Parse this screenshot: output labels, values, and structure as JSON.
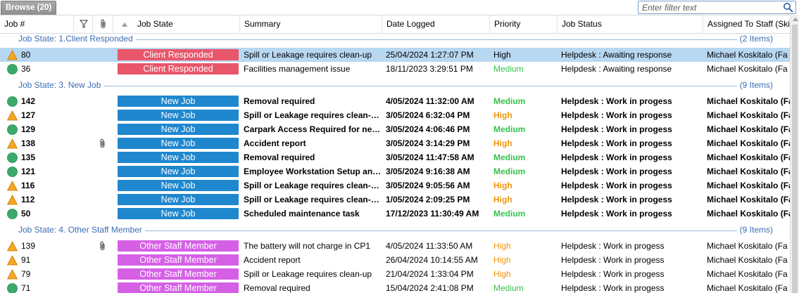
{
  "tab": {
    "label": "Browse (20)"
  },
  "filter": {
    "placeholder": "Enter filter text"
  },
  "columns": {
    "job_no": "Job #",
    "job_state": "Job State",
    "summary": "Summary",
    "date_logged": "Date Logged",
    "priority": "Priority",
    "job_status": "Job Status",
    "assigned": "Assigned To Staff (Ski"
  },
  "groups": [
    {
      "label": "Job State: 1.Client Responded",
      "count": "(2 Items)",
      "rows": [
        {
          "icon": "warning",
          "job": "80",
          "state": "Client Responded",
          "state_kind": "client",
          "summary": "Spill or Leakage requires clean-up",
          "date": "25/04/2024 1:27:07 PM",
          "priority": "High",
          "status": "Helpdesk : Awaiting response",
          "assigned": "Michael Koskitalo (Fa",
          "bold": false,
          "selected": true,
          "attach": false
        },
        {
          "icon": "circle",
          "job": "36",
          "state": "Client Responded",
          "state_kind": "client",
          "summary": "Facilities management issue",
          "date": "18/11/2023 3:29:51 PM",
          "priority": "Medium",
          "status": "Helpdesk : Awaiting response",
          "assigned": "Michael Koskitalo (Fa",
          "bold": false,
          "selected": false,
          "attach": false
        }
      ]
    },
    {
      "label": "Job State: 3. New Job",
      "count": "(9 Items)",
      "rows": [
        {
          "icon": "circle",
          "job": "142",
          "state": "New Job",
          "state_kind": "new",
          "summary": "Removal required",
          "date": "4/05/2024 11:32:00 AM",
          "priority": "Medium",
          "status": "Helpdesk : Work in progess",
          "assigned": "Michael Koskitalo (Fa",
          "bold": true,
          "selected": false,
          "attach": false
        },
        {
          "icon": "warning",
          "job": "127",
          "state": "New Job",
          "state_kind": "new",
          "summary": "Spill or Leakage requires clean-…",
          "date": "3/05/2024 6:32:04 PM",
          "priority": "High",
          "status": "Helpdesk : Work in progess",
          "assigned": "Michael Koskitalo (Fa",
          "bold": true,
          "selected": false,
          "attach": false
        },
        {
          "icon": "circle",
          "job": "129",
          "state": "New Job",
          "state_kind": "new",
          "summary": "Carpark Access Required for ne…",
          "date": "3/05/2024 4:06:46 PM",
          "priority": "Medium",
          "status": "Helpdesk : Work in progess",
          "assigned": "Michael Koskitalo (Fa",
          "bold": true,
          "selected": false,
          "attach": false
        },
        {
          "icon": "warning",
          "job": "138",
          "state": "New Job",
          "state_kind": "new",
          "summary": "Accident report",
          "date": "3/05/2024 3:14:29 PM",
          "priority": "High",
          "status": "Helpdesk : Work in progess",
          "assigned": "Michael Koskitalo (Fa",
          "bold": true,
          "selected": false,
          "attach": true
        },
        {
          "icon": "circle",
          "job": "135",
          "state": "New Job",
          "state_kind": "new",
          "summary": "Removal required",
          "date": "3/05/2024 11:47:58 AM",
          "priority": "Medium",
          "status": "Helpdesk : Work in progess",
          "assigned": "Michael Koskitalo (Fa",
          "bold": true,
          "selected": false,
          "attach": false
        },
        {
          "icon": "circle",
          "job": "121",
          "state": "New Job",
          "state_kind": "new",
          "summary": "Employee Workstation Setup an…",
          "date": "3/05/2024 9:16:38 AM",
          "priority": "Medium",
          "status": "Helpdesk : Work in progess",
          "assigned": "Michael Koskitalo (Fa",
          "bold": true,
          "selected": false,
          "attach": false
        },
        {
          "icon": "warning",
          "job": "116",
          "state": "New Job",
          "state_kind": "new",
          "summary": "Spill or Leakage requires clean-…",
          "date": "3/05/2024 9:05:56 AM",
          "priority": "High",
          "status": "Helpdesk : Work in progess",
          "assigned": "Michael Koskitalo (Fa",
          "bold": true,
          "selected": false,
          "attach": false
        },
        {
          "icon": "warning",
          "job": "112",
          "state": "New Job",
          "state_kind": "new",
          "summary": "Spill or Leakage requires clean-…",
          "date": "1/05/2024 2:09:25 PM",
          "priority": "High",
          "status": "Helpdesk : Work in progess",
          "assigned": "Michael Koskitalo (Fa",
          "bold": true,
          "selected": false,
          "attach": false
        },
        {
          "icon": "circle",
          "job": "50",
          "state": "New Job",
          "state_kind": "new",
          "summary": "Scheduled maintenance task",
          "date": "17/12/2023 11:30:49 AM",
          "priority": "Medium",
          "status": "Helpdesk : Work in progess",
          "assigned": "Michael Koskitalo (Fa",
          "bold": true,
          "selected": false,
          "attach": false
        }
      ]
    },
    {
      "label": "Job State: 4. Other Staff Member",
      "count": "(9 Items)",
      "rows": [
        {
          "icon": "warning",
          "job": "139",
          "state": "Other Staff Member",
          "state_kind": "other",
          "summary": "The battery will not charge in CP1",
          "date": "4/05/2024 11:33:50 AM",
          "priority": "High",
          "status": "Helpdesk : Work in progess",
          "assigned": "Michael Koskitalo (Fa",
          "bold": false,
          "selected": false,
          "attach": true
        },
        {
          "icon": "warning",
          "job": "91",
          "state": "Other Staff Member",
          "state_kind": "other",
          "summary": "Accident report",
          "date": "26/04/2024 10:14:55 AM",
          "priority": "High",
          "status": "Helpdesk : Work in progess",
          "assigned": "Michael Koskitalo (Fa",
          "bold": false,
          "selected": false,
          "attach": false
        },
        {
          "icon": "warning",
          "job": "79",
          "state": "Other Staff Member",
          "state_kind": "other",
          "summary": "Spill or Leakage requires clean-up",
          "date": "21/04/2024 1:33:04 PM",
          "priority": "High",
          "status": "Helpdesk : Work in progess",
          "assigned": "Michael Koskitalo (Fa",
          "bold": false,
          "selected": false,
          "attach": false
        },
        {
          "icon": "circle",
          "job": "71",
          "state": "Other Staff Member",
          "state_kind": "other",
          "summary": "Removal required",
          "date": "15/04/2024 2:41:08 PM",
          "priority": "Medium",
          "status": "Helpdesk : Work in progess",
          "assigned": "Michael Koskitalo (Fa",
          "bold": false,
          "selected": false,
          "attach": false
        }
      ]
    }
  ],
  "colors": {
    "client": "#e8566a",
    "new": "#1f87ce",
    "other": "#d560e6",
    "high": "#f0960e",
    "medium": "#36c24c",
    "selected_row": "#b8d7f1",
    "group_text": "#3b6db5"
  }
}
